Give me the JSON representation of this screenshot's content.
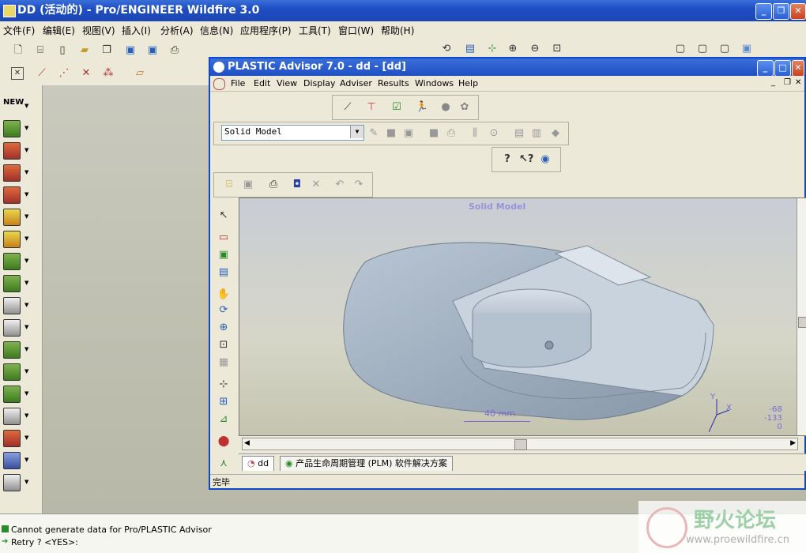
{
  "outer": {
    "title": "DD (活动的) - Pro/ENGINEER Wildfire 3.0",
    "menu": [
      "文件(F)",
      "编辑(E)",
      "视图(V)",
      "插入(I)",
      "分析(A)",
      "信息(N)",
      "应用程序(P)",
      "工具(T)",
      "窗口(W)",
      "帮助(H)"
    ]
  },
  "inner": {
    "title": "PLASTIC Advisor 7.0 - dd - [dd]",
    "menu": [
      "File",
      "Edit",
      "View",
      "Display",
      "Adviser",
      "Results",
      "Windows",
      "Help"
    ],
    "model_select": "Solid Model",
    "viewport_label": "Solid Model",
    "scale_label": "40 mm",
    "axis": {
      "y": "Y",
      "x": "X"
    },
    "coords": [
      "-68",
      "-133",
      "0"
    ],
    "tabs": [
      "dd",
      "产品生命周期管理 (PLM) 软件解决方案"
    ],
    "status": "完毕"
  },
  "messages": [
    "Cannot generate data for Pro/PLASTIC Advisor",
    "Retry ? <YES>:"
  ],
  "watermark": {
    "cn": "野火论坛",
    "url": "www.proewildfire.cn"
  },
  "colors": {
    "titlebar": "#1f4fc4",
    "accent": "#7b6ad6",
    "model": "#a9b8c8"
  }
}
